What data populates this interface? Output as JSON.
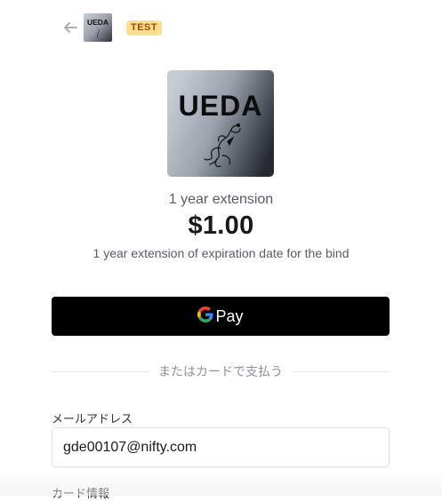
{
  "header": {
    "back_icon": "arrow-left-icon",
    "merchant_logo_text": "UEDA",
    "test_badge": "TEST"
  },
  "product": {
    "image_logo_text": "UEDA",
    "name": "1 year extension",
    "price": "$1.00",
    "description": "1 year extension of expiration date for the bind"
  },
  "payment": {
    "gpay_label": "Pay",
    "gpay_icon": "google-g-icon",
    "divider_text": "またはカードで支払う"
  },
  "form": {
    "email_label": "メールアドレス",
    "email_value": "gde00107@nifty.com",
    "card_label": "カード情報"
  },
  "colors": {
    "badge_bg": "#ffde92",
    "badge_text": "#a24a00",
    "gpay_bg": "#000000",
    "google_blue": "#4285F4",
    "google_red": "#EA4335",
    "google_yellow": "#FBBC05",
    "google_green": "#34A853"
  }
}
